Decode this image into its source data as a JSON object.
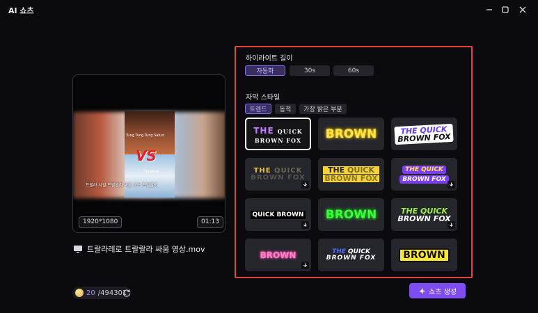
{
  "window": {
    "title": "AI 쇼츠",
    "buttons": {
      "minimize": "minimize-icon",
      "maximize": "maximize-icon",
      "close": "close-icon"
    }
  },
  "preview": {
    "resolution": "1920*1080",
    "duration": "01:13",
    "caption_top": "Tung Tung Tung Sahur",
    "caption_bottom": "Tralalero",
    "vs_text": "VS",
    "subtitle": "트랄라 사힐 트랄랄라 싸움 오브 트랄랄로"
  },
  "file": {
    "icon": "monitor-icon",
    "name": "트랄라레로 트랄랄라 싸움 영상.mov"
  },
  "credits": {
    "used": "20",
    "total": "/494301",
    "refresh_icon": "refresh-icon"
  },
  "panel": {
    "highlight_title": "하이라이트 길이",
    "durations": [
      "자동화",
      "30s",
      "60s"
    ],
    "active_duration": "자동화",
    "style_title": "자막 스타일",
    "style_tabs": [
      "트렌드",
      "동적",
      "가장 밝은 부분"
    ],
    "active_tab": "트렌드",
    "styles": {
      "s1": {
        "line1": "THE",
        "line1b": "QUICK",
        "line2": "BROWN FOX"
      },
      "s2": {
        "text": "BROWN"
      },
      "s3": {
        "line1": "THE QUICK",
        "line2": "BROWN FOX"
      },
      "s4": {
        "line1": "THE",
        "line1b": "QUICK",
        "line2": "BROWN FOX"
      },
      "s5": {
        "line1": "THE",
        "line1b": "QUICK",
        "line2": "BROWN FOX"
      },
      "s6": {
        "line1": "THE QUICK",
        "line2": "BROWN FOX"
      },
      "s7": {
        "text": "QUICK BROWN"
      },
      "s8": {
        "text": "BROWN"
      },
      "s9": {
        "line1": "THE QUICK",
        "line2": "BROWN FOX"
      },
      "s10": {
        "text": "BROWN"
      },
      "s11": {
        "line1": "THE",
        "line1b": "QUICK",
        "line2": "BROWN FOX"
      },
      "s12": {
        "text": "BROWN"
      }
    },
    "download_icon": "download-icon"
  },
  "generate": {
    "label": "쇼츠 생성",
    "icon": "sparkle-icon"
  }
}
